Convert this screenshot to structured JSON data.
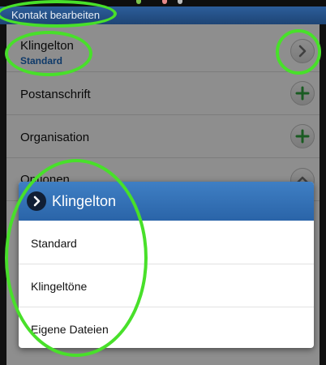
{
  "title_bar": {
    "title": "Kontakt bearbeiten"
  },
  "rows": [
    {
      "label": "Klingelton",
      "value": "Standard",
      "icon": "chevron-right-icon"
    },
    {
      "label": "Postanschrift",
      "icon": "plus-icon"
    },
    {
      "label": "Organisation",
      "icon": "plus-icon"
    },
    {
      "label": "Optionen",
      "icon": "chevron-up-icon"
    }
  ],
  "dialog": {
    "title": "Klingelton",
    "icon": "chevron-right-icon",
    "options": [
      "Standard",
      "Klingeltöne",
      "Eigene Dateien"
    ]
  },
  "colors": {
    "title_bar": "#1e4575",
    "dialog_header": "#3f7fc4",
    "value_text": "#1b64b5",
    "plus_icon": "#2e9e3b",
    "annotation": "#48e02a"
  }
}
